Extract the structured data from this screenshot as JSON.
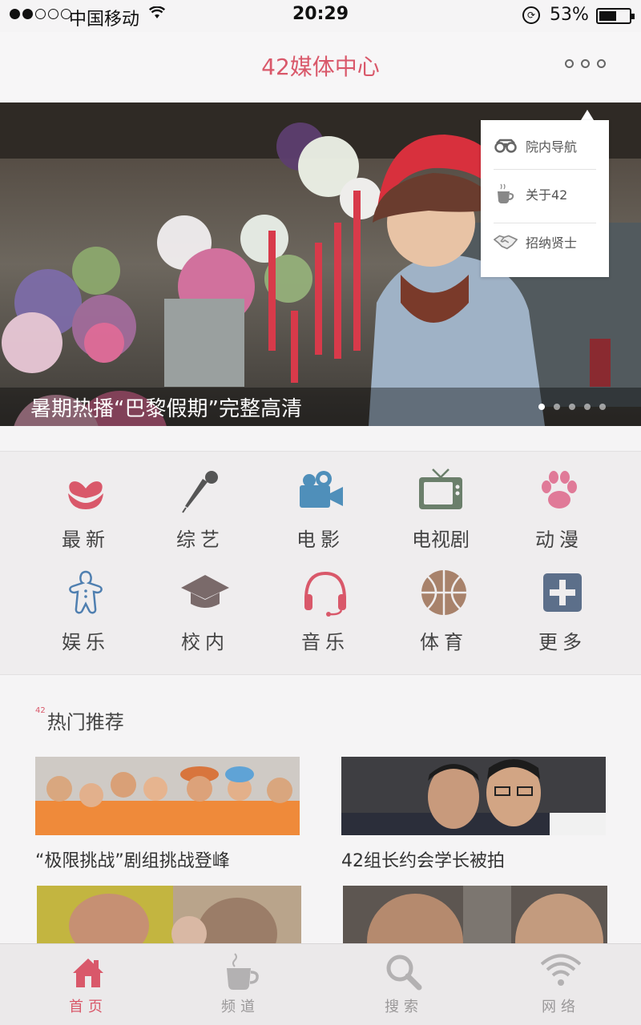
{
  "status_bar": {
    "carrier": "中国移动",
    "time": "20:29",
    "battery": "53%"
  },
  "nav": {
    "title": "42媒体中心"
  },
  "banner": {
    "caption": "暑期热播“巴黎假期”完整高清",
    "page_count": 5,
    "active_index": 0
  },
  "popover": {
    "items": [
      {
        "label": "院内导航",
        "icon": "binoculars-icon"
      },
      {
        "label": "关于42",
        "icon": "coffee-cup-icon"
      },
      {
        "label": "招纳贤士",
        "icon": "handshake-icon"
      }
    ]
  },
  "categories": [
    {
      "label": "最新",
      "icon": "tulip-heart-icon",
      "color": "#d9586a"
    },
    {
      "label": "综艺",
      "icon": "microphone-icon",
      "color": "#555555"
    },
    {
      "label": "电影",
      "icon": "video-camera-icon",
      "color": "#4f8fba"
    },
    {
      "label": "电视剧",
      "icon": "tv-icon",
      "color": "#6b7f6b"
    },
    {
      "label": "动漫",
      "icon": "paw-icon",
      "color": "#e07a98"
    },
    {
      "label": "娱乐",
      "icon": "gingerbread-icon",
      "color": "#4f7fb0"
    },
    {
      "label": "校内",
      "icon": "graduation-cap-icon",
      "color": "#7a6a6a"
    },
    {
      "label": "音乐",
      "icon": "headphones-icon",
      "color": "#d9586a"
    },
    {
      "label": "体育",
      "icon": "basketball-icon",
      "color": "#a8826b"
    },
    {
      "label": "更多",
      "icon": "plus-box-icon",
      "color": "#5c6f8a"
    }
  ],
  "hot": {
    "title": "热门推荐",
    "badge": "42",
    "items": [
      {
        "title": "“极限挑战”剧组挑战登峰"
      },
      {
        "title": "42组长约会学长被拍"
      },
      {
        "title": ""
      },
      {
        "title": ""
      }
    ]
  },
  "tabs": [
    {
      "label": "首页",
      "icon": "home-icon",
      "active": true
    },
    {
      "label": "频道",
      "icon": "coffee-icon",
      "active": false
    },
    {
      "label": "搜索",
      "icon": "search-icon",
      "active": false
    },
    {
      "label": "网络",
      "icon": "wifi-icon",
      "active": false
    }
  ],
  "colors": {
    "accent": "#d9586a",
    "tab_inactive": "#9a9899"
  }
}
